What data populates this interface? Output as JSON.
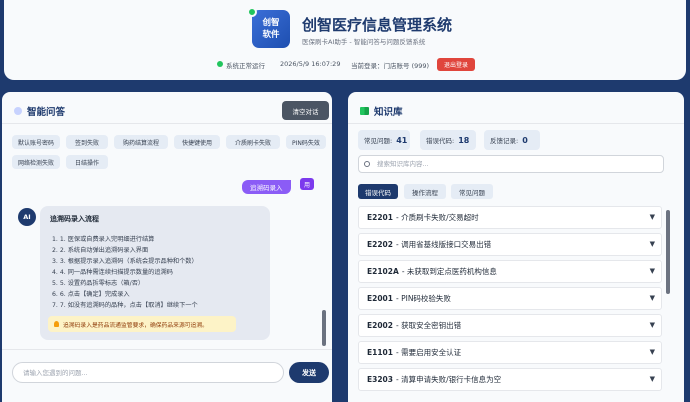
{
  "header": {
    "logo_text": "创智\n软件",
    "title": "创智医疗信息管理系统",
    "subtitle": "医保刷卡AI助手 - 智能问答与问题反馈系统",
    "status": "系统正常运行",
    "datetime": "2026/5/9 16:07:29",
    "current_login": "当前登录：门店账号 (999)",
    "logout_label": "退出登录"
  },
  "chat": {
    "title": "智能问答",
    "clear_label": "清空对话",
    "quick_chips": [
      "默认账号密码",
      "签到失败",
      "购药结算流程",
      "快捷键使用",
      "介质刷卡失败",
      "PIN码失效",
      "网络检测失败",
      "日结操作"
    ],
    "user_message": "追溯码录入",
    "user_avatar": "用",
    "ai_avatar": "AI",
    "ai_title": "追溯码录入流程",
    "ai_steps": [
      "1. 1. 医保或自费录入完明细进行结算",
      "2. 2. 系统自动弹出追溯码录入界面",
      "3. 3. 根据提示录入追溯码（系统会提示品种和个数）",
      "4. 4. 同一品种需连续扫描提示数量的追溯码",
      "5. 5. 设置药品拆零标志（箱/否）",
      "6. 6. 点击【确定】完成录入",
      "7. 7. 如没有追溯码的品种，点击【取消】继续下一个"
    ],
    "ai_tip": "追溯码录入是药品流通监管要求，确保药品来源可追溯。",
    "input_placeholder": "请输入您遇到的问题...",
    "send_label": "发送"
  },
  "kb": {
    "title": "知识库",
    "stats": [
      {
        "label": "常见问题:",
        "value": "41"
      },
      {
        "label": "错误代码:",
        "value": "18"
      },
      {
        "label": "反馈记录:",
        "value": "0"
      }
    ],
    "search_placeholder": "搜索知识库内容...",
    "tabs": [
      "错误代码",
      "操作流程",
      "常见问题"
    ],
    "active_tab": "错误代码",
    "items": [
      {
        "code": "E2201",
        "desc": "- 介质刷卡失败/交易超时"
      },
      {
        "code": "E2202",
        "desc": "- 调用省基线版接口交易出错"
      },
      {
        "code": "E2102A",
        "desc": "- 未获取到定点医药机构信息"
      },
      {
        "code": "E2001",
        "desc": "- PIN码校验失败"
      },
      {
        "code": "E2002",
        "desc": "- 获取安全密钥出错"
      },
      {
        "code": "E1101",
        "desc": "- 需要启用安全认证"
      },
      {
        "code": "E3203",
        "desc": "- 清算申请失败/银行卡信息为空"
      }
    ]
  },
  "colors": {
    "primary": "#1e3a6e",
    "background": "#1e3a6e",
    "danger": "#e0453c",
    "user_bubble": "#8b5cf6",
    "status_ok": "#22c55e"
  }
}
